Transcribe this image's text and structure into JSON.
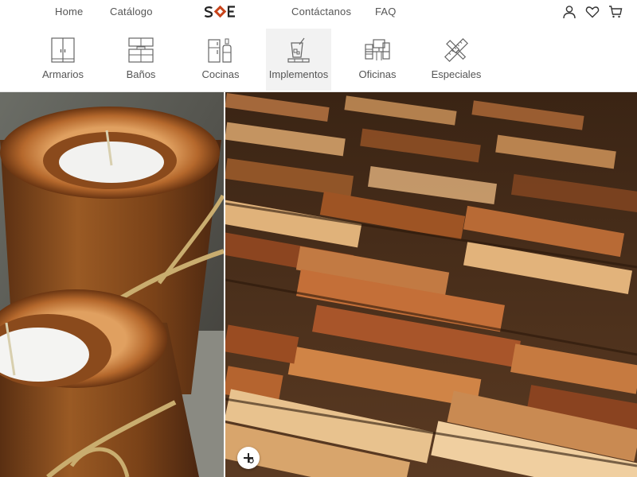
{
  "colors": {
    "brand_red": "#c8441b",
    "brand_dark": "#222222",
    "text": "#555555",
    "active_bg": "#f2f2f2"
  },
  "topnav": {
    "home": "Home",
    "catalog": "Catálogo",
    "logo_text": "SOE",
    "contact": "Contáctanos",
    "faq": "FAQ"
  },
  "user_actions": [
    {
      "icon": "user-icon"
    },
    {
      "icon": "heart-icon"
    },
    {
      "icon": "cart-icon"
    }
  ],
  "categories": [
    {
      "label": "Armarios",
      "icon": "wardrobe-icon",
      "active": false
    },
    {
      "label": "Baños",
      "icon": "bathroom-cabinet-icon",
      "active": false
    },
    {
      "label": "Cocinas",
      "icon": "kitchen-icon",
      "active": false
    },
    {
      "label": "Implementos",
      "icon": "implements-icon",
      "active": true
    },
    {
      "label": "Oficinas",
      "icon": "office-icon",
      "active": false
    },
    {
      "label": "Especiales",
      "icon": "tools-icon",
      "active": false
    }
  ],
  "hero": {
    "left_image": "wooden-log-candles",
    "right_image": "wooden-pallet-coasters",
    "zoom_icon": "zoom-in-icon"
  }
}
